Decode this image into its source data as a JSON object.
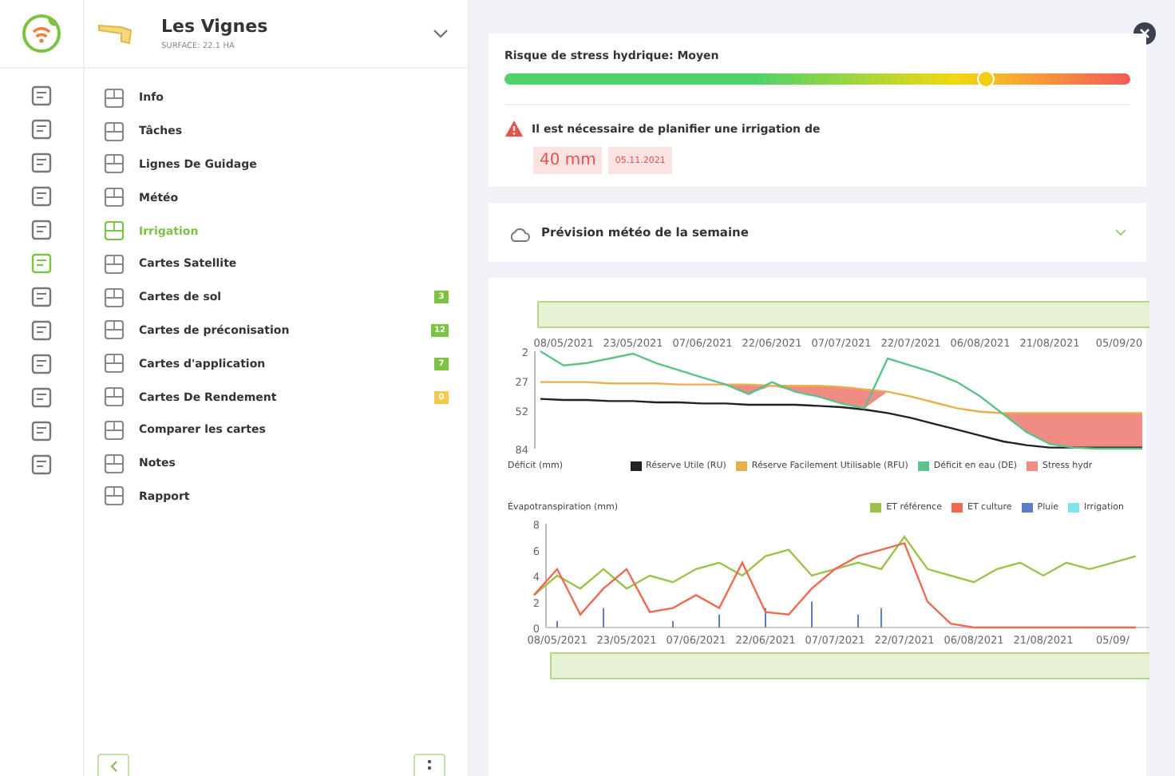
{
  "field": {
    "name": "Les Vignes",
    "surface": "SURFACE: 22.1 HA"
  },
  "rail": [
    {
      "selected": false
    },
    {
      "selected": false
    },
    {
      "selected": false
    },
    {
      "selected": false
    },
    {
      "selected": false
    },
    {
      "selected": true
    },
    {
      "selected": false
    },
    {
      "selected": false
    },
    {
      "selected": false
    },
    {
      "selected": false
    },
    {
      "selected": false
    },
    {
      "selected": false
    }
  ],
  "menu": [
    {
      "label": "Info",
      "selected": false
    },
    {
      "label": "Tâches",
      "selected": false
    },
    {
      "label": "Lignes De Guidage",
      "selected": false
    },
    {
      "label": "Météo",
      "selected": false
    },
    {
      "label": "Irrigation",
      "selected": true
    },
    {
      "label": "Cartes Satellite",
      "selected": false
    },
    {
      "label": "Cartes de sol",
      "selected": false,
      "badge": "3",
      "color": "#7cc243"
    },
    {
      "label": "Cartes de préconisation",
      "selected": false,
      "badge": "12",
      "color": "#7cc243"
    },
    {
      "label": "Cartes d'application",
      "selected": false,
      "badge": "7",
      "color": "#7cc243"
    },
    {
      "label": "Cartes De Rendement",
      "selected": false,
      "badge": "0",
      "color": "#f5c94c"
    },
    {
      "label": "Comparer les cartes",
      "selected": false
    },
    {
      "label": "Notes",
      "selected": false
    },
    {
      "label": "Rapport",
      "selected": false
    }
  ],
  "risk": {
    "title": "Risque de stress hydrique: Moyen",
    "level": 0.77,
    "alert": "Il est nécessaire de planifier une irrigation de",
    "amount": "40 mm",
    "date": "05.11.2021"
  },
  "forecast": {
    "title": "Prévision météo de la semaine",
    "expanded": false
  },
  "deficit_chart": {
    "chart_data": {
      "type": "line",
      "ylabel": "Déficit (mm)",
      "legend": "bottom",
      "categories": [
        null,
        "08/05/2021",
        null,
        null,
        "23/05/2021",
        null,
        null,
        "07/06/2021",
        null,
        null,
        "22/06/2021",
        null,
        null,
        "07/07/2021",
        null,
        null,
        "22/07/2021",
        null,
        null,
        "06/08/2021",
        null,
        null,
        "21/08/2021",
        null,
        null,
        "05/09/20",
        null
      ],
      "yticks": [
        2,
        27,
        52,
        84
      ],
      "ylim": [
        84,
        2
      ],
      "series": [
        {
          "name": "Réserve Utile (RU)",
          "color": "#222222",
          "values": [
            42,
            43,
            43,
            44,
            44,
            45,
            45,
            46,
            46,
            47,
            47,
            47,
            48,
            49,
            51,
            54,
            58,
            63,
            68,
            73,
            78,
            81,
            83,
            83,
            83,
            83,
            83
          ]
        },
        {
          "name": "Réserve Facilement Utilisable (RFU)",
          "color": "#e8b04a",
          "values": [
            28,
            28,
            28,
            29,
            29,
            29,
            30,
            30,
            30,
            30,
            31,
            31,
            31,
            32,
            34,
            36,
            40,
            45,
            50,
            53,
            54,
            54,
            54,
            54,
            54,
            54,
            54
          ]
        },
        {
          "name": "Déficit en eau (DE)",
          "color": "#5dc28a",
          "values": [
            2,
            14,
            12,
            8,
            4,
            12,
            18,
            24,
            30,
            38,
            28,
            36,
            40,
            46,
            50,
            8,
            14,
            20,
            28,
            40,
            55,
            70,
            80,
            83,
            84,
            84,
            84
          ]
        },
        {
          "name": "Stress hydr",
          "type": "area",
          "color": "#f08c84",
          "values": [
            28,
            28,
            28,
            29,
            29,
            29,
            30,
            30,
            30,
            38,
            31,
            36,
            40,
            46,
            50,
            36,
            40,
            45,
            50,
            53,
            55,
            70,
            80,
            83,
            84,
            84,
            84
          ]
        }
      ]
    }
  },
  "et_chart": {
    "chart_data": {
      "type": "line",
      "ylabel": "Évapotranspiration (mm)",
      "legend": "top-right",
      "categories": [
        null,
        "08/05/2021",
        null,
        null,
        "23/05/2021",
        null,
        null,
        "07/06/2021",
        null,
        null,
        "22/06/2021",
        null,
        null,
        "07/07/2021",
        null,
        null,
        "22/07/2021",
        null,
        null,
        "06/08/2021",
        null,
        null,
        "21/08/2021",
        null,
        null,
        "05/09/",
        null
      ],
      "yticks": [
        0,
        2,
        4,
        6,
        8
      ],
      "ylim": [
        0,
        8
      ],
      "series": [
        {
          "name": "ET référence",
          "color": "#9bc34a",
          "values": [
            2.5,
            4,
            3,
            4.5,
            3,
            4,
            3.5,
            4.5,
            5,
            4,
            5.5,
            6,
            4,
            4.5,
            5,
            4.5,
            7,
            4.5,
            4,
            3.5,
            4.5,
            5,
            4,
            5,
            4.5,
            5,
            5.5
          ]
        },
        {
          "name": "ET culture",
          "color": "#ef6a50",
          "values": [
            2.5,
            4.5,
            1,
            3,
            4.5,
            1.2,
            1.5,
            2.5,
            1.5,
            5,
            1.2,
            1,
            3,
            4.5,
            5.5,
            6,
            6.5,
            2,
            0.3,
            0,
            0,
            0,
            0,
            0,
            0,
            0,
            0
          ]
        },
        {
          "name": "Pluie",
          "type": "bar",
          "color": "#5b7fc7",
          "values": [
            0,
            0.5,
            0,
            1.5,
            0,
            0,
            0.5,
            0,
            1,
            0,
            1.5,
            0,
            2,
            0,
            1,
            1.5,
            0,
            0,
            0,
            0,
            0,
            0,
            0,
            0,
            0,
            0,
            0
          ]
        },
        {
          "name": "Irrigation",
          "type": "bar",
          "color": "#7fe3ee",
          "values": [
            0,
            0,
            0,
            0,
            0,
            0,
            0,
            0,
            0,
            0,
            0,
            0,
            0,
            0,
            0,
            0,
            0,
            0,
            0,
            0,
            0,
            0,
            0,
            0,
            0,
            0,
            0
          ]
        }
      ]
    }
  }
}
